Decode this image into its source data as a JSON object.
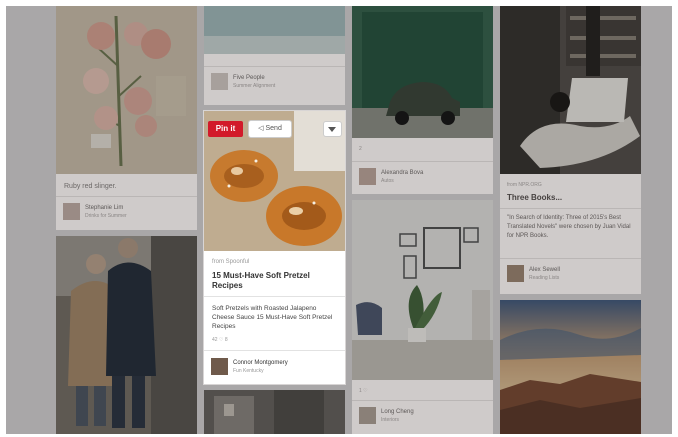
{
  "col1": {
    "pin1": {
      "caption": "Ruby red slinger.",
      "user": "Stephanie Lim",
      "board": "Drinks for Summer"
    }
  },
  "col2": {
    "pin_top": {
      "user": "Five People",
      "board": "Summer Alignment"
    },
    "focus": {
      "pin_label": "Pin it",
      "send_label": "Send",
      "source": "from Spoonful",
      "title": "15 Must-Have Soft Pretzel Recipes",
      "description": "Soft Pretzels with Roasted Jalapeno Cheese Sauce 15 Must-Have Soft Pretzel Recipes",
      "stats": "42 ♡   8",
      "user": "Connor Montgomery",
      "board": "Fun Kentucky"
    }
  },
  "col3": {
    "pin1": {
      "stats": "2",
      "user": "Alexandra Bova",
      "board": "Autos"
    },
    "pin2": {
      "stats": "1 ♡",
      "user": "Long Cheng",
      "board": "Interiors"
    }
  },
  "col4": {
    "pin1": {
      "source": "from NPR.ORG",
      "title": "Three Books...",
      "description": "\"In Search of Identity: Three of 2015's Best Translated Novels\" were chosen by Juan Vidal for NPR Books.",
      "user": "Alex Sewell",
      "board": "Reading Lists"
    }
  },
  "icons": {
    "more": "chevron-down-icon",
    "send": "send-icon"
  },
  "colors": {
    "pin_button": "#d21a2a",
    "backdrop": "#a9a7a8",
    "card": "#cfcbca"
  }
}
